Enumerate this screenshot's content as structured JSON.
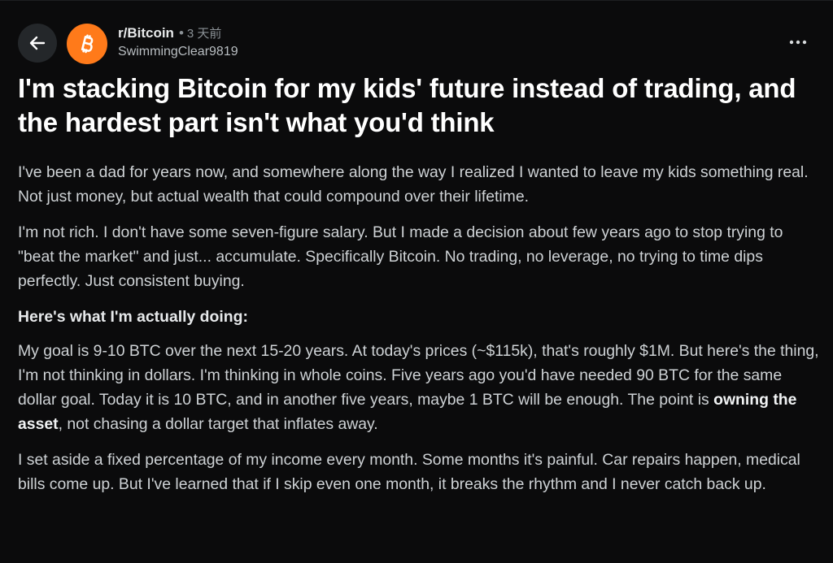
{
  "header": {
    "back_icon": "arrow-left-icon",
    "avatar_icon": "bitcoin-icon",
    "subreddit": "r/Bitcoin",
    "separator": "•",
    "time_ago": "3 天前",
    "username": "SwimmingClear9819",
    "more_icon": "more-horizontal-icon"
  },
  "post": {
    "title": "I'm stacking Bitcoin for my kids' future instead of trading, and the hardest part isn't what you'd think",
    "paragraphs": {
      "p1": "I've been a dad for years now, and somewhere along the way I realized I wanted to leave my kids something real. Not just money, but actual wealth that could compound over their lifetime.",
      "p2": "I'm not rich. I don't have some seven-figure salary. But I made a decision about few years ago to stop trying to \"beat the market\" and just... accumulate. Specifically Bitcoin. No trading, no leverage, no trying to time dips perfectly. Just consistent buying.",
      "heading": "Here's what I'm actually doing:",
      "p3_before": "My goal is 9-10 BTC over the next 15-20 years. At today's prices (~$115k), that's roughly $1M. But here's the thing, I'm not thinking in dollars. I'm thinking in whole coins. Five years ago you'd have needed 90 BTC for the same dollar goal. Today it is 10 BTC, and in another five years, maybe 1 BTC will be enough. The point is ",
      "p3_bold": "owning the asset",
      "p3_after": ", not chasing a dollar target that inflates away.",
      "p4": "I set aside a fixed percentage of my income every month. Some months it's painful. Car repairs happen, medical bills come up. But I've learned that if I skip even one month, it breaks the rhythm and I never catch back up."
    }
  },
  "colors": {
    "background": "#0b0b0c",
    "avatar": "#ff7a1a",
    "back_button": "#24272a"
  }
}
